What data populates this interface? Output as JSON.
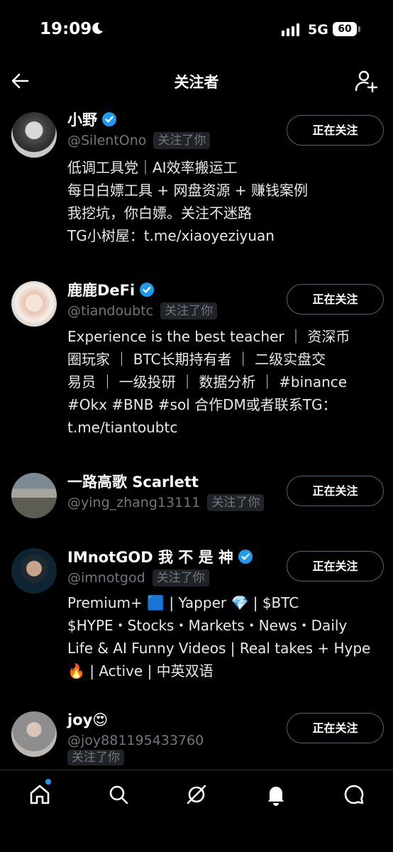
{
  "status_bar": {
    "time": "19:09",
    "network": "5G",
    "battery": "60"
  },
  "nav": {
    "title": "关注者"
  },
  "users": [
    {
      "name": "小野",
      "verified": true,
      "handle": "@SilentOno",
      "follows_you": "关注了你",
      "button": "正在关注",
      "bio": [
        "低调工具党｜AI效率搬运工",
        "每日白嫖工具 + 网盘资源 + 赚钱案例",
        "我挖坑，你白嫖。关注不迷路",
        "TG小树屋：t.me/xiaoyeziyuan"
      ]
    },
    {
      "name": "鹿鹿DeFi",
      "verified": true,
      "handle": "@tiandoubtc",
      "follows_you": "关注了你",
      "button": "正在关注",
      "bio": [
        "Experience is the best teacher ｜ 资深币",
        "圈玩家 ｜ BTC长期持有者 ｜ 二级实盘交",
        "易员 ｜ 一级投研 ｜ 数据分析 ｜ #binance",
        "#Okx #BNB #sol 合作DM或者联系TG：",
        "t.me/tiantoubtc"
      ]
    },
    {
      "name": "一路高歌 Scarlett",
      "verified": false,
      "handle": "@ying_zhang13111",
      "follows_you": "关注了你",
      "button": "正在关注",
      "bio": []
    },
    {
      "name": "IMnotGOD 我 不 是 神",
      "verified": true,
      "handle": "@imnotgod",
      "follows_you": "关注了你",
      "button": "正在关注",
      "bio": [
        "Premium+ 🟦 | Yapper 💎 | $BTC",
        "$HYPE・Stocks・Markets・News・Daily",
        "Life & AI Funny Videos | Real takes + Hype",
        "🔥 | Active | 中英双语"
      ]
    },
    {
      "name": "joy😍",
      "verified": false,
      "handle": "@joy881195433760",
      "follows_you": "关注了你",
      "button": "正在关注",
      "bio": []
    }
  ],
  "bottom_nav": {
    "tabs": [
      "home-icon",
      "search-icon",
      "grok-icon",
      "notifications-icon",
      "messages-icon"
    ]
  },
  "colors": {
    "background": "#000000",
    "text": "#e7e9ea",
    "muted": "#71767b",
    "verified": "#1d9bf0",
    "border": "#536471"
  }
}
